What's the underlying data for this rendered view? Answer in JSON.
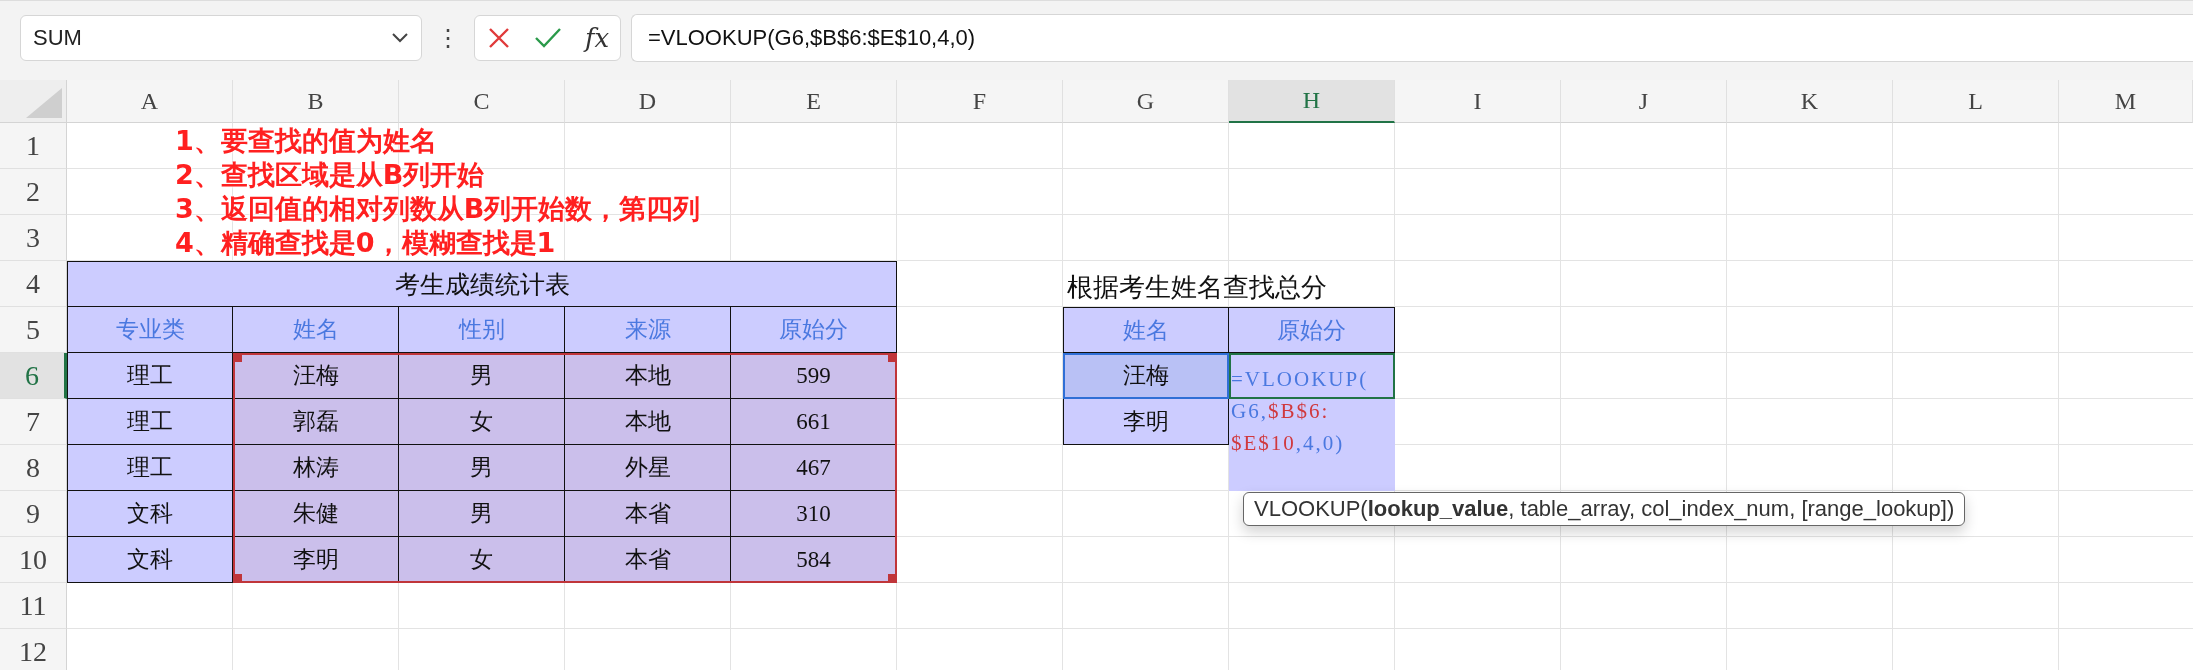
{
  "toolbar": {
    "name_box": "SUM",
    "more": "⋮",
    "fx": "fx",
    "formula": "=VLOOKUP(G6,$B$6:$E$10,4,0)"
  },
  "annotations": [
    "1、要查找的值为姓名",
    "2、查找区域是从B列开始",
    "3、返回值的相对列数从B列开始数，第四列",
    "4、精确查找是0，模糊查找是1"
  ],
  "columns": [
    {
      "label": "A",
      "selected": false
    },
    {
      "label": "B",
      "selected": false
    },
    {
      "label": "C",
      "selected": false
    },
    {
      "label": "D",
      "selected": false
    },
    {
      "label": "E",
      "selected": false
    },
    {
      "label": "F",
      "selected": false
    },
    {
      "label": "G",
      "selected": false
    },
    {
      "label": "H",
      "selected": true
    },
    {
      "label": "I",
      "selected": false
    },
    {
      "label": "J",
      "selected": false
    },
    {
      "label": "K",
      "selected": false
    },
    {
      "label": "L",
      "selected": false
    },
    {
      "label": "M",
      "selected": false
    }
  ],
  "rows": [
    {
      "label": "1",
      "selected": false
    },
    {
      "label": "2",
      "selected": false
    },
    {
      "label": "3",
      "selected": false
    },
    {
      "label": "4",
      "selected": false
    },
    {
      "label": "5",
      "selected": false
    },
    {
      "label": "6",
      "selected": true
    },
    {
      "label": "7",
      "selected": false
    },
    {
      "label": "8",
      "selected": false
    },
    {
      "label": "9",
      "selected": false
    },
    {
      "label": "10",
      "selected": false
    },
    {
      "label": "11",
      "selected": false
    },
    {
      "label": "12",
      "selected": false
    }
  ],
  "score_table": {
    "title": "考生成绩统计表",
    "headers": [
      "专业类",
      "姓名",
      "性别",
      "来源",
      "原始分"
    ],
    "rows": [
      [
        "理工",
        "汪梅",
        "男",
        "本地",
        "599"
      ],
      [
        "理工",
        "郭磊",
        "女",
        "本地",
        "661"
      ],
      [
        "理工",
        "林涛",
        "男",
        "外星",
        "467"
      ],
      [
        "文科",
        "朱健",
        "男",
        "本省",
        "310"
      ],
      [
        "文科",
        "李明",
        "女",
        "本省",
        "584"
      ]
    ]
  },
  "lookup_table": {
    "title": "根据考生姓名查找总分",
    "headers": [
      "姓名",
      "原始分"
    ],
    "names": [
      {
        "text": "汪梅",
        "selected": true
      },
      {
        "text": "李明",
        "selected": false
      }
    ],
    "editing_formula": [
      [
        {
          "text": "=VLOOKUP(",
          "color": "#4a78e0"
        }
      ],
      [
        {
          "text": "G6,",
          "color": "#4a78e0"
        },
        {
          "text": "$B$6:",
          "color": "#d0393e"
        }
      ],
      [
        {
          "text": "$E$10",
          "color": "#d0393e"
        },
        {
          "text": ",4,0)",
          "color": "#4a78e0"
        }
      ]
    ]
  },
  "tooltip": "VLOOKUP(**lookup_value**, table_array, col_index_num, [range_lookup])"
}
